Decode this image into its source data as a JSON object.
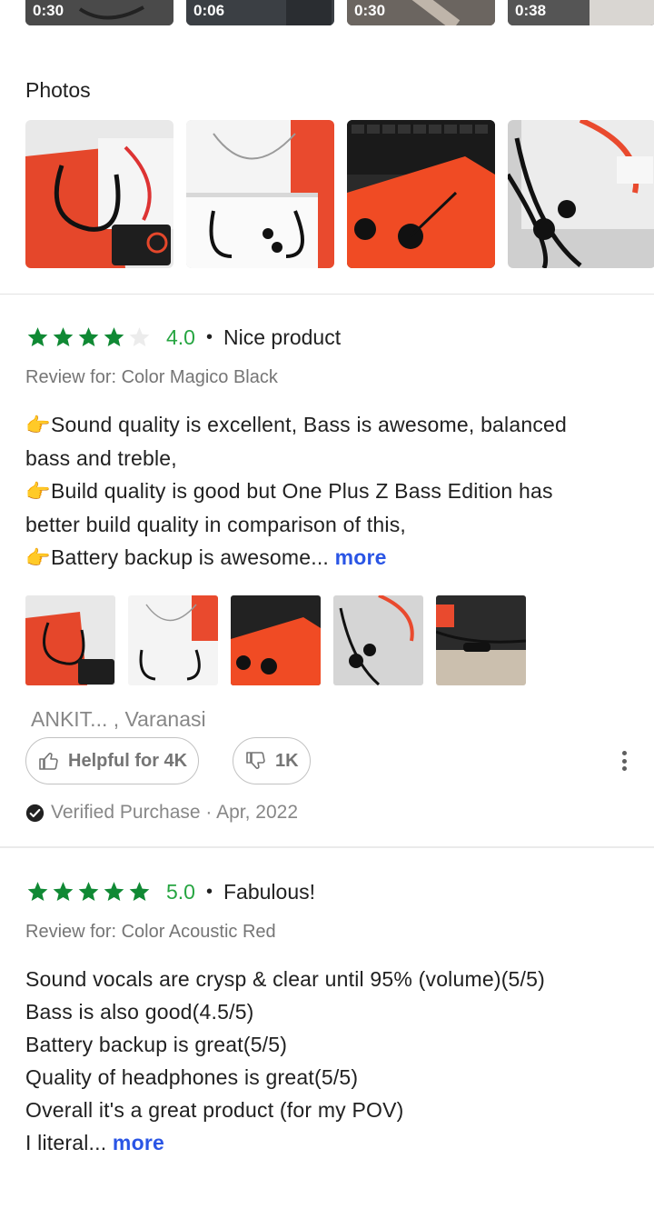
{
  "videos": [
    {
      "duration": "0:30"
    },
    {
      "duration": "0:06"
    },
    {
      "duration": "0:30"
    },
    {
      "duration": "0:38"
    }
  ],
  "photos_section": {
    "title": "Photos"
  },
  "colors": {
    "star_green": "#26a541",
    "star_grey": "#e0e0e0",
    "link_blue": "#2a55e5",
    "muted_text": "#878787"
  },
  "reviews": [
    {
      "stars": 4,
      "rating": "4.0",
      "separator": "•",
      "title": "Nice product",
      "review_for": "Review for: Color Magico Black",
      "body_lines": [
        "Sound quality is excellent, Bass is awesome, balanced",
        "bass and treble,",
        "Build quality is good but One Plus Z Bass Edition has",
        "better build quality in comparison of this,",
        "Battery backup is awesome..."
      ],
      "more_label": "more",
      "author": "ANKIT... , Varanasi",
      "helpful_label": "Helpful for 4K",
      "dislike_count": "1K",
      "verified_text": "Verified Purchase · Apr, 2022"
    },
    {
      "stars": 5,
      "rating": "5.0",
      "separator": "•",
      "title": "Fabulous!",
      "review_for": "Review for: Color Acoustic Red",
      "body_lines": [
        "Sound vocals are crysp & clear until 95% (volume)(5/5)",
        "Bass is also good(4.5/5)",
        "Battery backup is great(5/5)",
        "Quality of headphones is great(5/5)",
        "Overall it's a great product (for my POV)",
        "I literal..."
      ],
      "more_label": "more"
    }
  ]
}
